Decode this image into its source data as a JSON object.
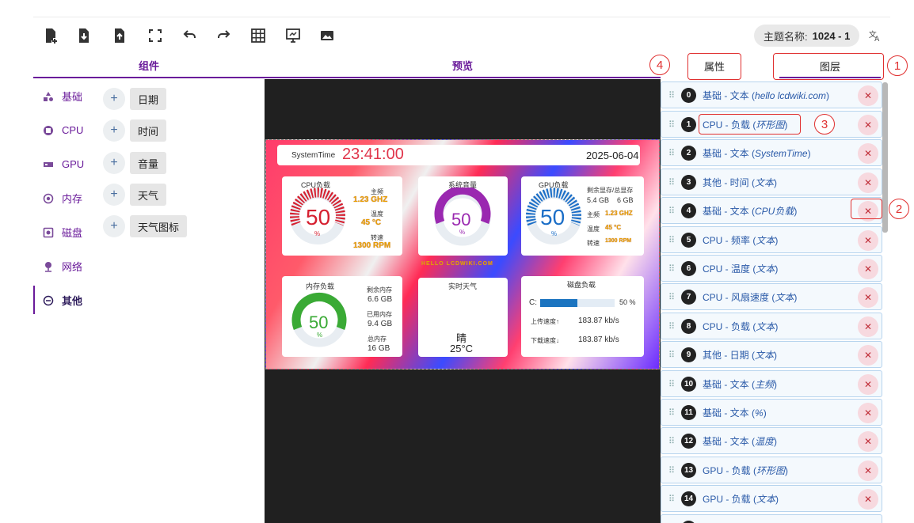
{
  "toolbar": {
    "icons": [
      "new-file-icon",
      "import-file-icon",
      "export-file-icon",
      "fullscreen-icon",
      "undo-icon",
      "redo-icon",
      "grid-icon",
      "screen-preview-icon",
      "image-icon"
    ],
    "theme_label": "主题名称:",
    "theme_value": "1024 - 1",
    "lang_icon": "translate-icon"
  },
  "sections": {
    "components": "组件",
    "preview": "预览"
  },
  "sidebar": {
    "items": [
      {
        "label": "基础",
        "icon": "shapes-icon"
      },
      {
        "label": "CPU",
        "icon": "cpu-icon"
      },
      {
        "label": "GPU",
        "icon": "gpu-icon"
      },
      {
        "label": "内存",
        "icon": "memory-icon"
      },
      {
        "label": "磁盘",
        "icon": "disk-icon"
      },
      {
        "label": "网络",
        "icon": "network-icon"
      },
      {
        "label": "其他",
        "icon": "other-icon"
      }
    ],
    "active": "其他"
  },
  "components": [
    "日期",
    "时间",
    "音量",
    "天气",
    "天气图标"
  ],
  "screen": {
    "system_time_label": "SystemTime",
    "time": "23:41:00",
    "date": "2025-06-04",
    "cpu": {
      "title": "CPU负载",
      "value": "50",
      "unit": "%",
      "freq_label": "主频",
      "freq": "1.23 GHZ",
      "temp_label": "温度",
      "temp": "45 °C",
      "fan_label": "转速",
      "fan": "1300 RPM"
    },
    "volume": {
      "title": "系统音量",
      "value": "50",
      "unit": "%"
    },
    "gpu": {
      "title": "GPU负载",
      "value": "50",
      "unit": "%",
      "vram_label": "剩余显存/总显存",
      "vram": "5.4 GB    6 GB",
      "freq_label": "主频",
      "freq": "1.23 GHZ",
      "temp_label": "温度",
      "temp": "45 °C",
      "fan_label": "转速",
      "fan": "1300 RPM"
    },
    "watermark": "HELLO LCDWIKI.COM",
    "memory": {
      "title": "内存负载",
      "value": "50",
      "unit": "%",
      "free_label": "剩余内存",
      "free": "6.6 GB",
      "used_label": "已用内存",
      "used": "9.4 GB",
      "total_label": "总内存",
      "total": "16 GB"
    },
    "weather": {
      "title": "实时天气",
      "condition": "晴",
      "temp": "25°C"
    },
    "disk": {
      "title": "磁盘负载",
      "drive": "C:",
      "percent": "50 %",
      "fill": 0.5,
      "upload_label": "上传速度↑",
      "upload": "183.87 kb/s",
      "download_label": "下载速度↓",
      "download": "183.87 kb/s"
    }
  },
  "panel": {
    "tab_properties": "属性",
    "tab_layers": "图层"
  },
  "callouts": [
    "1",
    "2",
    "3",
    "4"
  ],
  "layers": [
    {
      "num": "0",
      "name": "基础 - 文本",
      "detail": "hello lcdwiki.com"
    },
    {
      "num": "1",
      "name": "CPU - 负载",
      "detail": "环形图"
    },
    {
      "num": "2",
      "name": "基础 - 文本",
      "detail": "SystemTime"
    },
    {
      "num": "3",
      "name": "其他 - 时间",
      "detail": "文本"
    },
    {
      "num": "4",
      "name": "基础 - 文本",
      "detail": "CPU负载"
    },
    {
      "num": "5",
      "name": "CPU - 频率",
      "detail": "文本"
    },
    {
      "num": "6",
      "name": "CPU - 温度",
      "detail": "文本"
    },
    {
      "num": "7",
      "name": "CPU - 风扇速度",
      "detail": "文本"
    },
    {
      "num": "8",
      "name": "CPU - 负载",
      "detail": "文本"
    },
    {
      "num": "9",
      "name": "其他 - 日期",
      "detail": "文本"
    },
    {
      "num": "10",
      "name": "基础 - 文本",
      "detail": "主频"
    },
    {
      "num": "11",
      "name": "基础 - 文本",
      "detail": "%"
    },
    {
      "num": "12",
      "name": "基础 - 文本",
      "detail": "温度"
    },
    {
      "num": "13",
      "name": "GPU - 负载",
      "detail": "环形图"
    },
    {
      "num": "14",
      "name": "GPU - 负载",
      "detail": "文本"
    }
  ]
}
